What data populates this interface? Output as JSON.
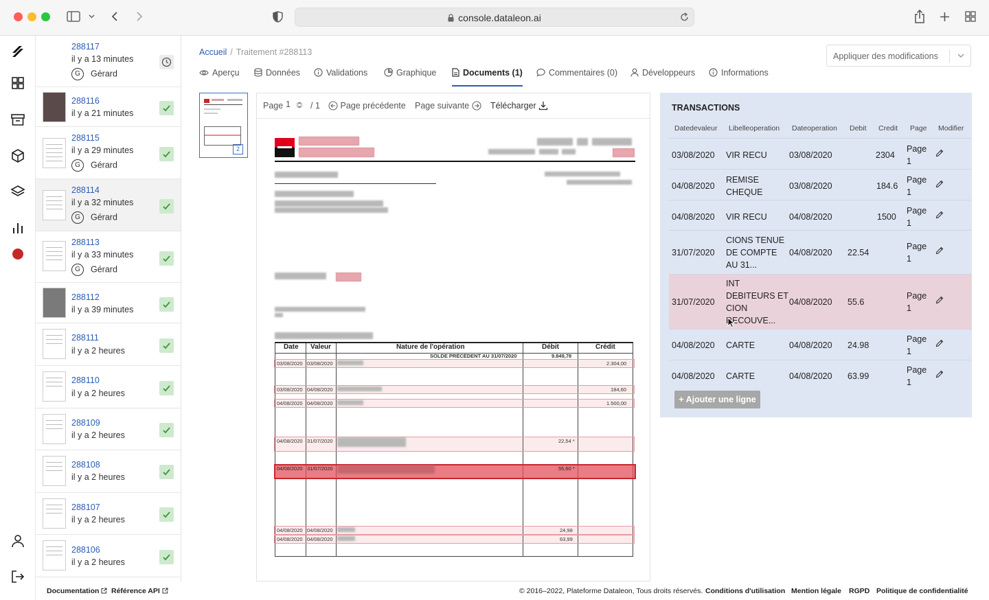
{
  "browser": {
    "url": "console.dataleon.ai"
  },
  "queue": [
    {
      "id": "288117",
      "time": "il y a 13 minutes",
      "user": "Gérard",
      "initial": "G",
      "status": "clock",
      "thumb": "doc"
    },
    {
      "id": "288116",
      "time": "il y a 21 minutes",
      "user": "",
      "initial": "",
      "status": "done",
      "thumb": "dark"
    },
    {
      "id": "288115",
      "time": "il y a 29 minutes",
      "user": "Gérard",
      "initial": "G",
      "status": "done",
      "thumb": "doc"
    },
    {
      "id": "288114",
      "time": "il y a 32 minutes",
      "user": "Gérard",
      "initial": "G",
      "status": "done",
      "thumb": "doc",
      "selected": true
    },
    {
      "id": "288113",
      "time": "il y a 33 minutes",
      "user": "Gérard",
      "initial": "G",
      "status": "done",
      "thumb": "doc"
    },
    {
      "id": "288112",
      "time": "il y a 39 minutes",
      "user": "",
      "initial": "",
      "status": "done",
      "thumb": "grey"
    },
    {
      "id": "288111",
      "time": "il y a 2 heures",
      "user": "",
      "initial": "",
      "status": "done",
      "thumb": "doc"
    },
    {
      "id": "288110",
      "time": "il y a 2 heures",
      "user": "",
      "initial": "",
      "status": "done",
      "thumb": "doc"
    },
    {
      "id": "288109",
      "time": "il y a 2 heures",
      "user": "",
      "initial": "",
      "status": "done",
      "thumb": "doc"
    },
    {
      "id": "288108",
      "time": "il y a 2 heures",
      "user": "",
      "initial": "",
      "status": "done",
      "thumb": "doc"
    },
    {
      "id": "288107",
      "time": "il y a 2 heures",
      "user": "",
      "initial": "",
      "status": "done",
      "thumb": "doc"
    },
    {
      "id": "288106",
      "time": "il y a 2 heures",
      "user": "",
      "initial": "",
      "status": "done",
      "thumb": "doc"
    }
  ],
  "breadcrumb": {
    "home": "Accueil",
    "separator": "/",
    "current": "Traitement #288113"
  },
  "apply_button": "Appliquer des modifications",
  "tabs": [
    {
      "label": "Aperçu",
      "icon": "eye-icon"
    },
    {
      "label": "Données",
      "icon": "database-icon"
    },
    {
      "label": "Validations",
      "icon": "info-icon"
    },
    {
      "label": "Graphique",
      "icon": "pie-chart-icon"
    },
    {
      "label": "Documents (1)",
      "icon": "document-icon",
      "active": true
    },
    {
      "label": "Commentaires (0)",
      "icon": "comment-icon"
    },
    {
      "label": "Développeurs",
      "icon": "user-icon"
    },
    {
      "label": "Informations",
      "icon": "info-icon"
    }
  ],
  "page_thumb": {
    "number": "2"
  },
  "viewer": {
    "page_label": "Page",
    "page_value": "1",
    "page_total": "/ 1",
    "prev": "Page précédente",
    "next": "Page suivante",
    "download": "Télécharger"
  },
  "statement": {
    "headers": [
      "Date",
      "Valeur",
      "Nature de l'opération",
      "Débit",
      "Crédit"
    ],
    "balance_label": "SOLDE PRÉCÉDENT AU 31/07/2020",
    "balance_value": "9.849,78",
    "lines": [
      {
        "date": "03/08/2020",
        "valeur": "03/08/2020",
        "debit": "",
        "credit": "2.304,00"
      },
      {
        "date": "03/08/2020",
        "valeur": "04/08/2020",
        "debit": "",
        "credit": "184,60"
      },
      {
        "date": "04/08/2020",
        "valeur": "04/08/2020",
        "debit": "",
        "credit": "1.500,00"
      },
      {
        "date": "04/08/2020",
        "valeur": "31/07/2020",
        "debit": "22,54 *",
        "credit": ""
      },
      {
        "date": "04/08/2020",
        "valeur": "31/07/2020",
        "debit": "55,60 *",
        "credit": ""
      },
      {
        "date": "04/08/2020",
        "valeur": "04/08/2020",
        "debit": "24,98",
        "credit": ""
      },
      {
        "date": "04/08/2020",
        "valeur": "04/08/2020",
        "debit": "63,99",
        "credit": ""
      }
    ]
  },
  "transactions": {
    "title": "TRANSACTIONS",
    "columns": [
      "Datedevaleur",
      "Libelleoperation",
      "Dateoperation",
      "Debit",
      "Credit",
      "Page",
      "Modifier"
    ],
    "rows": [
      {
        "datevaleur": "03/08/2020",
        "libelle": [
          "VIR RECU"
        ],
        "dateop": "03/08/2020",
        "debit": "",
        "credit": "2304",
        "page": [
          "Page",
          "1"
        ]
      },
      {
        "datevaleur": "04/08/2020",
        "libelle": [
          "REMISE",
          "CHEQUE"
        ],
        "dateop": "03/08/2020",
        "debit": "",
        "credit": "184.6",
        "page": [
          "Page",
          "1"
        ]
      },
      {
        "datevaleur": "04/08/2020",
        "libelle": [
          "VIR RECU"
        ],
        "dateop": "04/08/2020",
        "debit": "",
        "credit": "1500",
        "page": [
          "Page",
          "1"
        ]
      },
      {
        "datevaleur": "31/07/2020",
        "libelle": [
          "CIONS TENUE",
          "DE COMPTE",
          "AU 31..."
        ],
        "dateop": "04/08/2020",
        "debit": "22.54",
        "credit": "",
        "page": [
          "Page",
          "1"
        ]
      },
      {
        "datevaleur": "31/07/2020",
        "libelle": [
          "INT",
          "DEBITEURS ET",
          "CION",
          "RECOUVE..."
        ],
        "dateop": "04/08/2020",
        "debit": "55.6",
        "credit": "",
        "page": [
          "Page",
          "1"
        ],
        "highlighted": true
      },
      {
        "datevaleur": "04/08/2020",
        "libelle": [
          "CARTE"
        ],
        "dateop": "04/08/2020",
        "debit": "24.98",
        "credit": "",
        "page": [
          "Page",
          "1"
        ]
      },
      {
        "datevaleur": "04/08/2020",
        "libelle": [
          "CARTE"
        ],
        "dateop": "04/08/2020",
        "debit": "63.99",
        "credit": "",
        "page": [
          "Page",
          "1"
        ]
      }
    ],
    "add_button": "+ Ajouter une ligne"
  },
  "footer": {
    "documentation": "Documentation",
    "api": "Référence API",
    "copyright": "© 2016–2022, Plateforme Dataleon, Tous droits réservés.",
    "links": [
      "Conditions d'utilisation",
      "Mention légale",
      "RGPD",
      "Politique de confidentialité"
    ]
  },
  "colors": {
    "accent": "#2a5db0",
    "panel": "#dfe6f3",
    "highlight_row": "#ead2da",
    "status_ok": "#cfe9cf",
    "brand_red": "#c62828"
  }
}
